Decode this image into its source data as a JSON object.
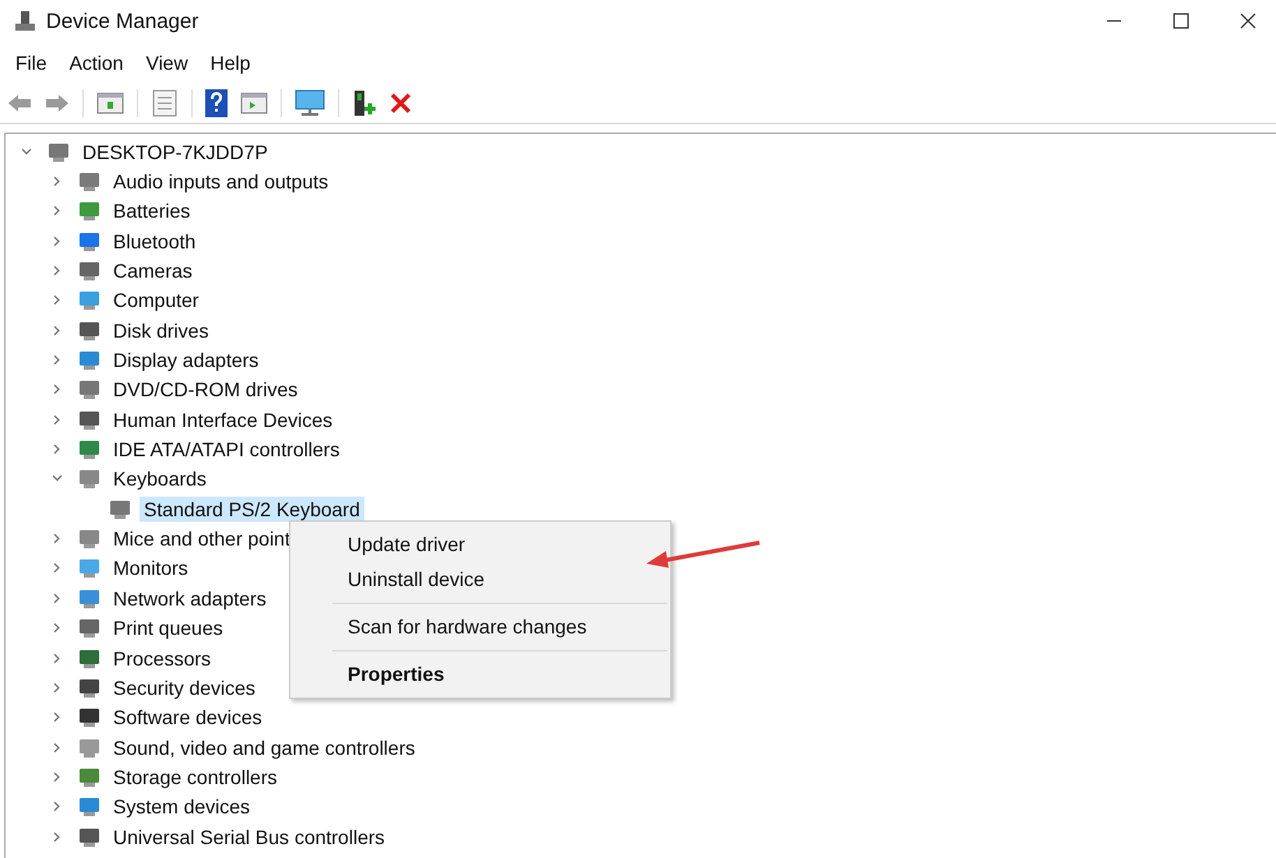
{
  "window": {
    "title": "Device Manager"
  },
  "menu_bar": [
    "File",
    "Action",
    "View",
    "Help"
  ],
  "tree": [
    {
      "label": "DESKTOP-7KJDD7P",
      "expanded": true,
      "selected": false,
      "children": [
        {
          "label": "Audio inputs and outputs",
          "expanded": false,
          "selected": false
        },
        {
          "label": "Batteries",
          "expanded": false,
          "selected": false
        },
        {
          "label": "Bluetooth",
          "expanded": false,
          "selected": false
        },
        {
          "label": "Cameras",
          "expanded": false,
          "selected": false
        },
        {
          "label": "Computer",
          "expanded": false,
          "selected": false
        },
        {
          "label": "Disk drives",
          "expanded": false,
          "selected": false
        },
        {
          "label": "Display adapters",
          "expanded": false,
          "selected": false
        },
        {
          "label": "DVD/CD-ROM drives",
          "expanded": false,
          "selected": false
        },
        {
          "label": "Human Interface Devices",
          "expanded": false,
          "selected": false
        },
        {
          "label": "IDE ATA/ATAPI controllers",
          "expanded": false,
          "selected": false
        },
        {
          "label": "Keyboards",
          "expanded": true,
          "selected": false,
          "children": [
            {
              "label": "Standard PS/2 Keyboard",
              "selected": true
            }
          ]
        },
        {
          "label": "Mice and other point",
          "expanded": false,
          "selected": false
        },
        {
          "label": "Monitors",
          "expanded": false,
          "selected": false
        },
        {
          "label": "Network adapters",
          "expanded": false,
          "selected": false
        },
        {
          "label": "Print queues",
          "expanded": false,
          "selected": false
        },
        {
          "label": "Processors",
          "expanded": false,
          "selected": false
        },
        {
          "label": "Security devices",
          "expanded": false,
          "selected": false
        },
        {
          "label": "Software devices",
          "expanded": false,
          "selected": false
        },
        {
          "label": "Sound, video and game controllers",
          "expanded": false,
          "selected": false
        },
        {
          "label": "Storage controllers",
          "expanded": false,
          "selected": false
        },
        {
          "label": "System devices",
          "expanded": false,
          "selected": false
        },
        {
          "label": "Universal Serial Bus controllers",
          "expanded": false,
          "selected": false
        }
      ]
    }
  ],
  "context_menu": [
    {
      "kind": "item",
      "label": "Update driver",
      "default": false
    },
    {
      "kind": "item",
      "label": "Uninstall device",
      "default": false
    },
    {
      "kind": "separator"
    },
    {
      "kind": "item",
      "label": "Scan for hardware changes",
      "default": false
    },
    {
      "kind": "separator"
    },
    {
      "kind": "item",
      "label": "Properties",
      "default": true
    }
  ]
}
